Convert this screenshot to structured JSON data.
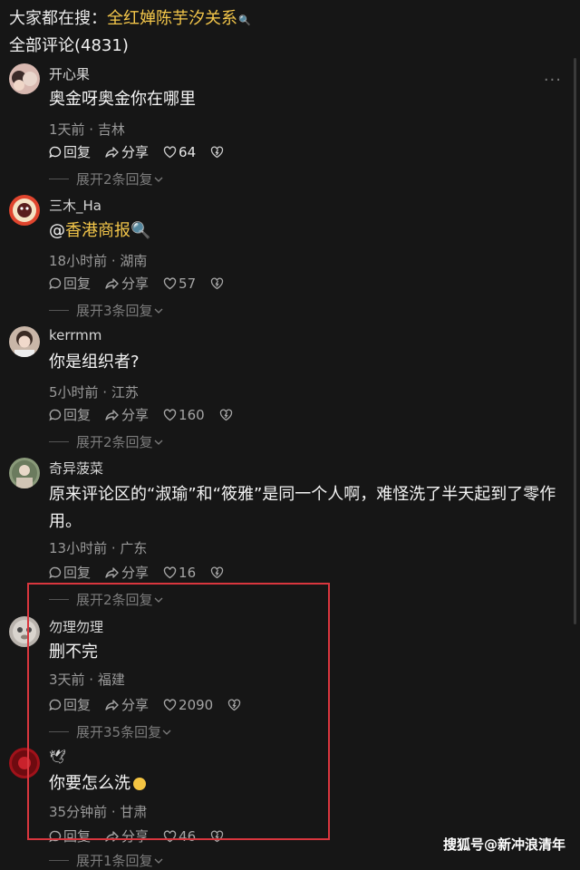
{
  "header": {
    "search_label": "大家都在搜：",
    "search_term": "全红婵陈芋汐关系",
    "search_icon": "🔍",
    "comment_count_label": "全部评论(4831)"
  },
  "actions": {
    "reply": "回复",
    "share": "分享"
  },
  "comments": [
    {
      "name": "开心果",
      "text": "奥金呀奥金你在哪里",
      "meta": "1天前 · 吉林",
      "likes": "64",
      "expand": "展开2条回复",
      "avatar_color": "#d8b8b0"
    },
    {
      "name": "三木_Ha",
      "text_prefix": "@",
      "text_link": "香港商报",
      "meta": "18小时前 · 湖南",
      "likes": "57",
      "expand": "展开3条回复",
      "avatar_color": "#e0452e"
    },
    {
      "name": "kerrmm",
      "text": "你是组织者?",
      "meta": "5小时前 · 江苏",
      "likes": "160",
      "expand": "展开2条回复",
      "avatar_color": "#c9b6a8"
    },
    {
      "name": "奇异菠菜",
      "text": "原来评论区的“淑瑜”和“筱雅”是同一个人啊，难怪洗了半天起到了零作用。",
      "meta": "13小时前 · 广东",
      "likes": "16",
      "expand": "展开2条回复",
      "avatar_color": "#8a9a7a"
    },
    {
      "name": "勿理勿理",
      "text": "删不完",
      "meta": "3天前 · 福建",
      "likes": "2090",
      "expand": "展开35条回复",
      "avatar_color": "#b9b3ad"
    },
    {
      "name": "🕊",
      "text": "你要怎么洗",
      "meta": "35分钟前 · 甘肃",
      "likes": "46",
      "expand": "展开1条回复",
      "avatar_color": "#a0121a"
    }
  ],
  "watermark": "搜狐号@新冲浪清年",
  "colors": {
    "accent": "#f3c64a",
    "highlight_box": "#d9363e",
    "background": "#161616"
  }
}
